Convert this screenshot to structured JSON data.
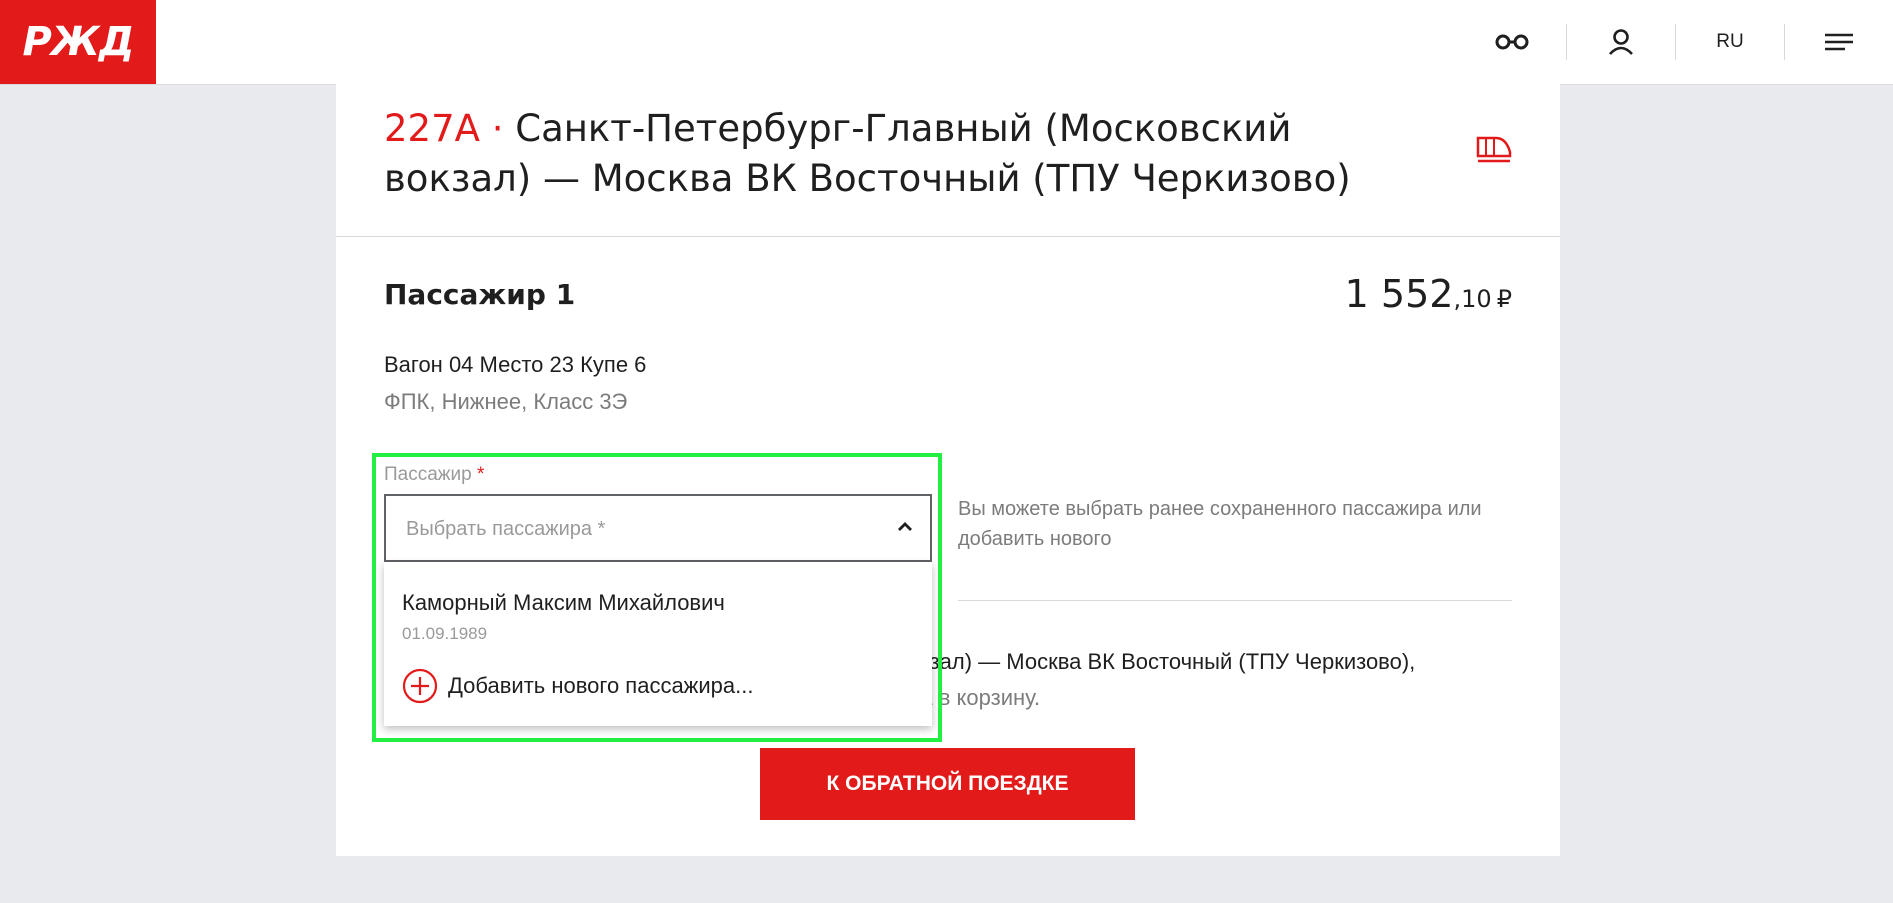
{
  "header": {
    "logo_text": "РЖД",
    "lang_label": "RU"
  },
  "train": {
    "number": "227А",
    "separator": "·",
    "route": "Санкт-Петербург-Главный (Московский вокзал) — Москва ВК Восточный (ТПУ Черкизово)"
  },
  "passenger": {
    "title": "Пассажир 1",
    "price_main": "1 552",
    "price_cents": ",10",
    "currency": "₽",
    "seat_info": "Вагон 04 Место 23 Купе 6",
    "car_info": "ФПК, Нижнее, Класс 3Э"
  },
  "form": {
    "field_label": "Пассажир",
    "required_mark": "*",
    "placeholder": "Выбрать пассажира *",
    "hint": "Вы можете выбрать ранее сохраненного пассажира или добавить нового"
  },
  "dropdown": {
    "option_name": "Каморный Максим Михайлович",
    "option_date": "01.09.1989",
    "add_label": "Добавить нового пассажира..."
  },
  "notice": {
    "line1": "вокзал) — Москва ВК Восточный (ТПУ Черкизово),",
    "line2": "ена в корзину."
  },
  "actions": {
    "return_label": "К ОБРАТНОЙ ПОЕЗДКЕ"
  },
  "colors": {
    "brand_red": "#e21a1a",
    "highlight": "#22ee44"
  }
}
